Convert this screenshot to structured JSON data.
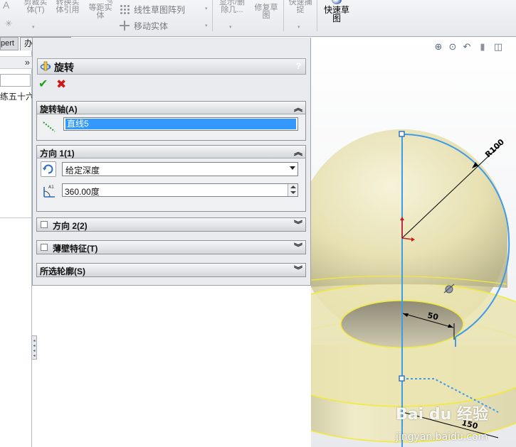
{
  "toolbar": {
    "trim_entities": "剪裁实\n体(T)",
    "convert_entities": "转换实\n体引用",
    "offset_entities": "等距实\n体",
    "linear_pattern": "线性草图阵列",
    "move_entities": "移动实体",
    "display_delete": "显示/删\n除几...",
    "repair_sketch": "修复草\n图",
    "quick_snaps": "快速捕\n捉",
    "rapid_sketch": "快速草\n图"
  },
  "tabs": {
    "expert_tab": "pert",
    "office_tab": "办公室产品"
  },
  "tree": {
    "expand_glyph": "»",
    "item_label": "练五十六"
  },
  "pm": {
    "title": "旋转",
    "help": "?",
    "ok_glyph": "✔",
    "cancel_glyph": "✖",
    "axis_group": {
      "title": "旋转轴(A)",
      "collapse_glyph": "︽",
      "value": "直线5"
    },
    "direction1": {
      "title": "方向 1(1)",
      "collapse_glyph": "︽",
      "end_condition": "给定深度",
      "angle": "360.00度"
    },
    "direction2": {
      "title": "方向 2(2)",
      "expand_glyph": "︾",
      "checked": false
    },
    "thin_feature": {
      "title": "薄壁特征(T)",
      "expand_glyph": "︾",
      "checked": false
    },
    "selected_contours": {
      "title": "所选轮廓(S)",
      "expand_glyph": "︾"
    }
  },
  "viewport": {
    "dim_radius": "R100",
    "dim_hole": "50",
    "dim_outer": "150",
    "colors": {
      "sketch_blue": "#3d9be9",
      "edge_yellow": "#f2ea3a",
      "body_fill": "#e9e3b4"
    }
  },
  "watermark": {
    "brand": "Bai du 经验",
    "url": "jingyan.baidu.com"
  }
}
